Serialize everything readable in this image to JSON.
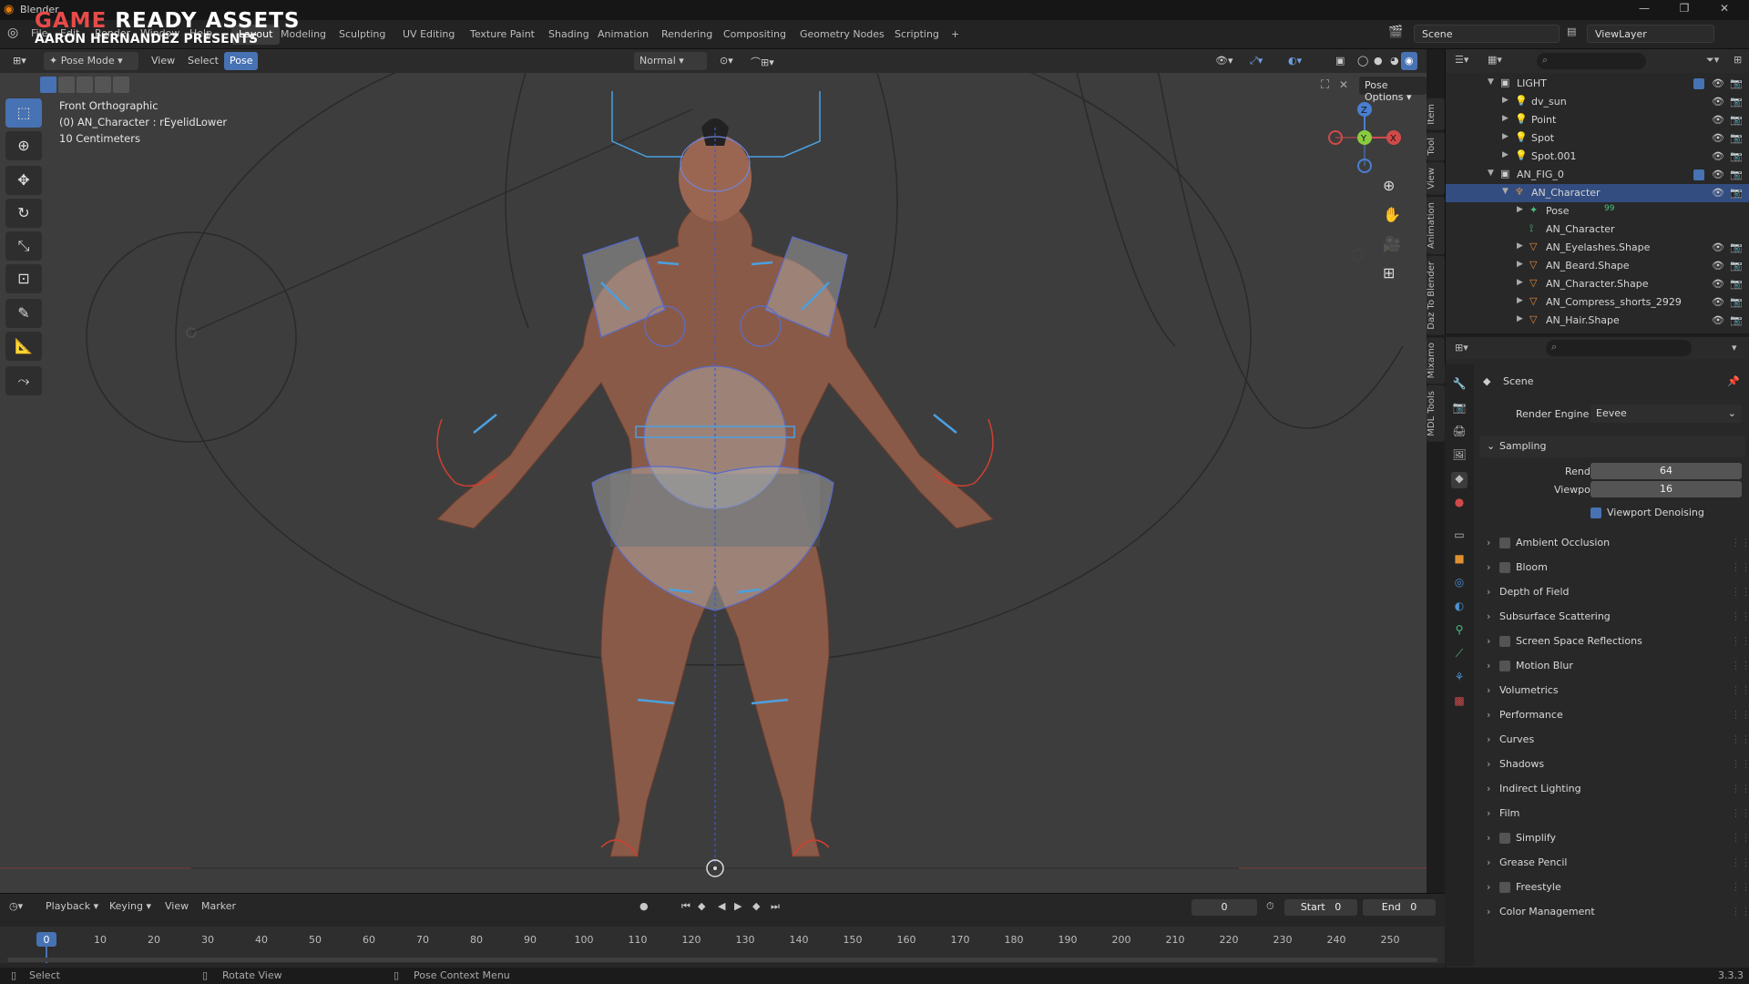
{
  "window": {
    "title": "Blender"
  },
  "overlay": {
    "line1_a": "GAME",
    "line1_b": " READY ASSETS",
    "line2": "AARON HERNANDEZ PRESENTS"
  },
  "menu": {
    "file": "File",
    "edit": "Edit",
    "render": "Render",
    "window": "Window",
    "help": "Help"
  },
  "workspaces": [
    "Layout",
    "Modeling",
    "Sculpting",
    "UV Editing",
    "Texture Paint",
    "Shading",
    "Animation",
    "Rendering",
    "Compositing",
    "Geometry Nodes",
    "Scripting"
  ],
  "active_workspace": "Layout",
  "add_tab": "+",
  "scene": "Scene",
  "view_layer": "ViewLayer",
  "viewport_header": {
    "mode": "Pose Mode",
    "view": "View",
    "select": "Select",
    "pose": "Pose",
    "orientation": "Normal",
    "pose_options": "Pose Options"
  },
  "viewport_info": {
    "view_name": "Front Orthographic",
    "object": "(0) AN_Character : rEyelidLower",
    "scale": "10 Centimeters"
  },
  "side_tabs": [
    "Item",
    "Tool",
    "View",
    "Animation",
    "Daz To Blender",
    "Mixamo",
    "MDL Tools"
  ],
  "gizmo": {
    "z": "Z",
    "y": "Y",
    "x": "X"
  },
  "timeline": {
    "playback": "Playback",
    "keying": "Keying",
    "view": "View",
    "marker": "Marker",
    "current_frame": "0",
    "start_label": "Start",
    "start": "0",
    "end_label": "End",
    "end": "0",
    "ticks": [
      "0",
      "10",
      "20",
      "30",
      "40",
      "50",
      "60",
      "70",
      "80",
      "90",
      "100",
      "110",
      "120",
      "130",
      "140",
      "150",
      "160",
      "170",
      "180",
      "190",
      "200",
      "210",
      "220",
      "230",
      "240",
      "250"
    ]
  },
  "status": {
    "select": "Select",
    "rotate": "Rotate View",
    "context": "Pose Context Menu",
    "version": "3.3.3"
  },
  "outliner": {
    "rows": [
      {
        "label": "LIGHT",
        "indent": 0,
        "type": "collection"
      },
      {
        "label": "dv_sun",
        "indent": 1,
        "type": "light"
      },
      {
        "label": "Point",
        "indent": 1,
        "type": "light"
      },
      {
        "label": "Spot",
        "indent": 1,
        "type": "light"
      },
      {
        "label": "Spot.001",
        "indent": 1,
        "type": "light"
      },
      {
        "label": "AN_FIG_0",
        "indent": 0,
        "type": "collection"
      },
      {
        "label": "AN_Character",
        "indent": 1,
        "type": "armature",
        "selected": true
      },
      {
        "label": "Pose",
        "indent": 2,
        "type": "pose",
        "badge": "99"
      },
      {
        "label": "AN_Character",
        "indent": 2,
        "type": "armature-data"
      },
      {
        "label": "AN_Eyelashes.Shape",
        "indent": 2,
        "type": "mesh"
      },
      {
        "label": "AN_Beard.Shape",
        "indent": 2,
        "type": "mesh"
      },
      {
        "label": "AN_Character.Shape",
        "indent": 2,
        "type": "mesh"
      },
      {
        "label": "AN_Compress_shorts_2929",
        "indent": 2,
        "type": "mesh"
      },
      {
        "label": "AN_Hair.Shape",
        "indent": 2,
        "type": "mesh"
      }
    ]
  },
  "properties": {
    "context": "Scene",
    "render_engine_label": "Render Engine",
    "render_engine": "Eevee",
    "sampling": "Sampling",
    "render_label": "Render",
    "render_value": "64",
    "viewport_label": "Viewport",
    "viewport_value": "16",
    "denoise_label": "Viewport Denoising",
    "panels": [
      {
        "label": "Ambient Occlusion",
        "check": true
      },
      {
        "label": "Bloom",
        "check": true
      },
      {
        "label": "Depth of Field",
        "check": false
      },
      {
        "label": "Subsurface Scattering",
        "check": false
      },
      {
        "label": "Screen Space Reflections",
        "check": true
      },
      {
        "label": "Motion Blur",
        "check": true
      },
      {
        "label": "Volumetrics",
        "check": false
      },
      {
        "label": "Performance",
        "check": false
      },
      {
        "label": "Curves",
        "check": false
      },
      {
        "label": "Shadows",
        "check": false
      },
      {
        "label": "Indirect Lighting",
        "check": false
      },
      {
        "label": "Film",
        "check": false
      },
      {
        "label": "Simplify",
        "check": true
      },
      {
        "label": "Grease Pencil",
        "check": false
      },
      {
        "label": "Freestyle",
        "check": true
      },
      {
        "label": "Color Management",
        "check": false
      }
    ]
  }
}
